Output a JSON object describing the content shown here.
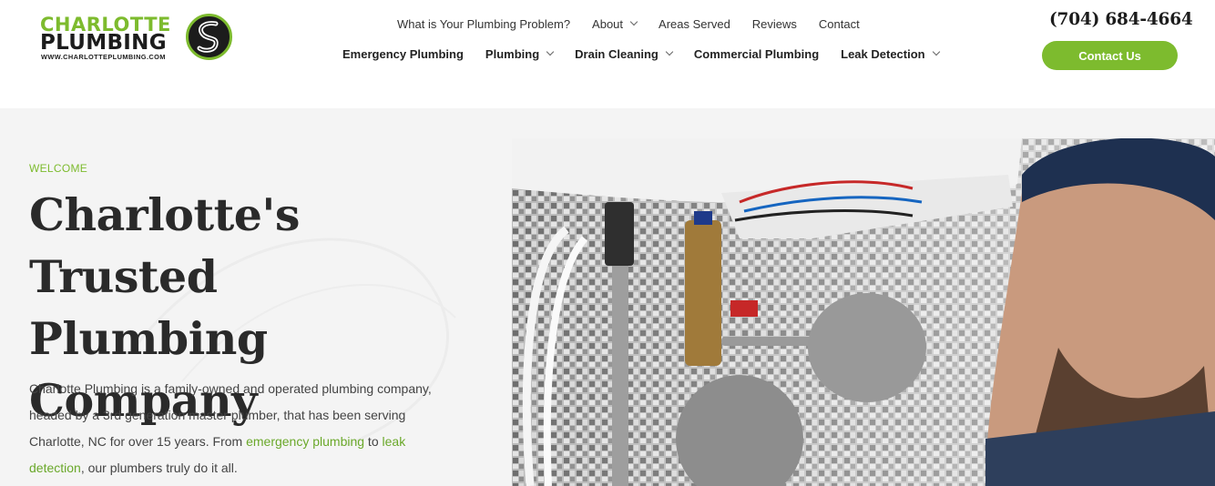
{
  "brand": {
    "line1": "CHARLOTTE",
    "line2": "PLUMBING",
    "url": "WWW.CHARLOTTEPLUMBING.COM",
    "accent": "#7dbb2e"
  },
  "top_nav": [
    {
      "label": "What is Your Plumbing Problem?",
      "dropdown": false
    },
    {
      "label": "About",
      "dropdown": true
    },
    {
      "label": "Areas Served",
      "dropdown": false
    },
    {
      "label": "Reviews",
      "dropdown": false
    },
    {
      "label": "Contact",
      "dropdown": false
    }
  ],
  "main_nav": [
    {
      "label": "Emergency Plumbing",
      "dropdown": false
    },
    {
      "label": "Plumbing",
      "dropdown": true
    },
    {
      "label": "Drain Cleaning",
      "dropdown": true
    },
    {
      "label": "Commercial Plumbing",
      "dropdown": false
    },
    {
      "label": "Leak Detection",
      "dropdown": true
    }
  ],
  "header": {
    "phone": "(704) 684-4664",
    "cta_label": "Contact Us"
  },
  "hero": {
    "eyebrow": "WELCOME",
    "title_lines": [
      "Charlotte's Trusted",
      "Plumbing",
      "Company"
    ],
    "desc_part1": "Charlotte Plumbing is a family-owned and operated plumbing company, headed by a 3rd generation master plumber, that has been serving Charlotte, NC for over 15 years. From ",
    "link1": "emergency plumbing",
    "desc_part2": " to ",
    "link2": "leak detection",
    "desc_part3": ", our plumbers truly do it all."
  }
}
